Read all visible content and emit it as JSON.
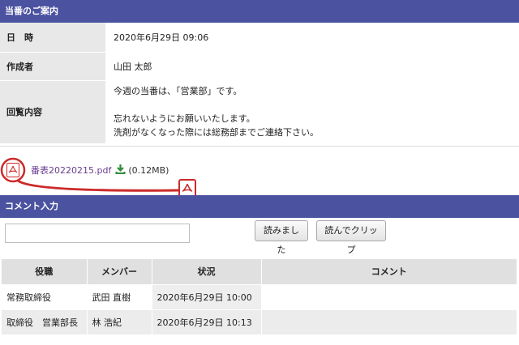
{
  "notice": {
    "header": "当番のご案内",
    "rows": [
      {
        "label": "日　時",
        "value": "2020年6月29日 09:06"
      },
      {
        "label": "作成者",
        "value": "山田 太郎"
      },
      {
        "label": "回覧内容",
        "lines": [
          "今週の当番は、「営業部」です。",
          "",
          "忘れないようにお願いいたします。",
          "洗剤がなくなった際には総務部までご連絡下さい。"
        ]
      }
    ]
  },
  "attachment": {
    "filename": "番表20220215.pdf",
    "size": "(0.12MB)",
    "icon": "pdf-icon",
    "download_icon": "download-icon",
    "accent_color": "#cc2a2a"
  },
  "comment": {
    "header": "コメント入力",
    "input_value": "",
    "read_button": "読みました",
    "clip_button": "読んでクリップ"
  },
  "list": {
    "headers": [
      "役職",
      "メンバー",
      "状況",
      "コメント"
    ],
    "rows": [
      {
        "role": "常務取締役",
        "member": "武田 直樹",
        "status": "2020年6月29日 10:00",
        "comment": ""
      },
      {
        "role": "取締役　営業部長",
        "member": "林 浩紀",
        "status": "2020年6月29日 10:13",
        "comment": ""
      }
    ]
  },
  "colors": {
    "header_bg": "#4b52a0",
    "label_bg": "#e8e8e8"
  }
}
